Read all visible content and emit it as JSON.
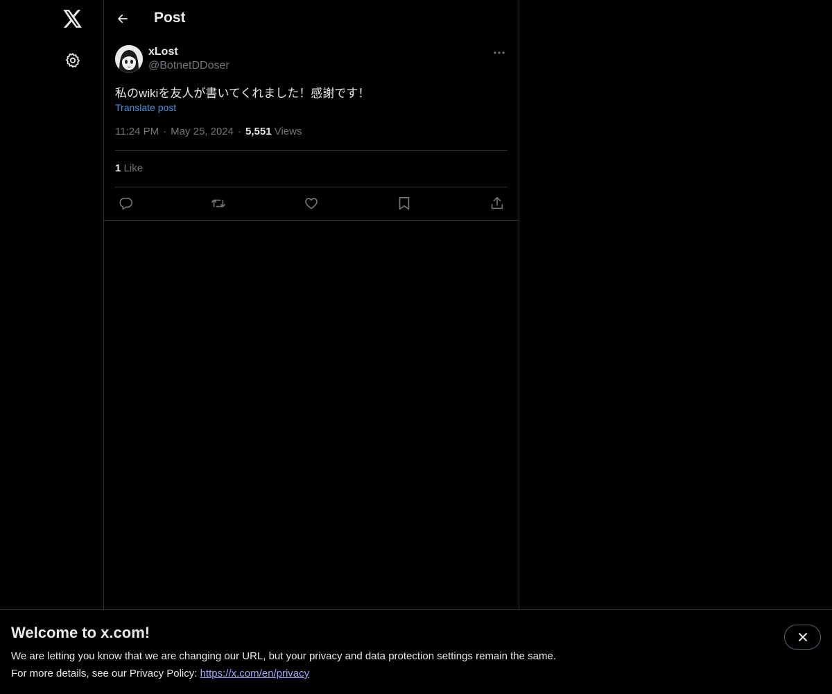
{
  "header": {
    "title": "Post"
  },
  "post": {
    "display_name": "xLost",
    "handle": "@BotnetDDoser",
    "text": "私のwikiを友人が書いてくれました！感謝です！",
    "translate_label": "Translate post",
    "time": "11:24 PM",
    "date": "May 25, 2024",
    "views_count": "5,551",
    "views_label": "Views",
    "likes_count": "1",
    "likes_label": "Like"
  },
  "banner": {
    "title": "Welcome to x.com!",
    "line1": "We are letting you know that we are changing our URL, but your privacy and data protection settings remain the same.",
    "line2_prefix": "For more details, see our Privacy Policy: ",
    "link": "https://x.com/en/privacy"
  },
  "icons": {
    "logo": "x-logo-icon",
    "settings": "gear-icon",
    "back": "arrow-left-icon",
    "more": "ellipsis-icon",
    "reply": "reply-icon",
    "repost": "repost-icon",
    "like": "heart-icon",
    "bookmark": "bookmark-icon",
    "share": "share-icon",
    "close": "close-icon"
  },
  "colors": {
    "background": "#000000",
    "text": "#e7e9ea",
    "secondary_text": "#71767b",
    "border": "#2f3336",
    "link": "#4a8fd9"
  }
}
